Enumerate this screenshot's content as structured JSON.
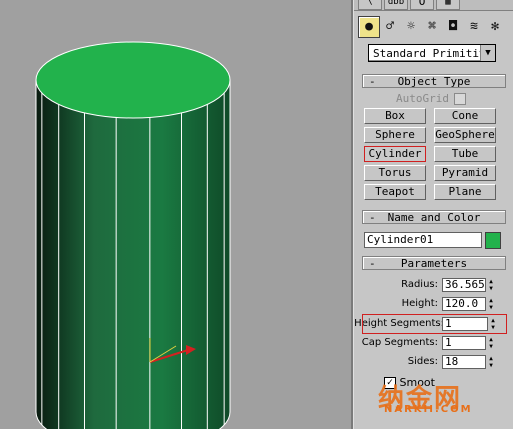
{
  "panel": {
    "tabs": [
      "\\",
      "dbb",
      "O",
      "▦"
    ],
    "icons": [
      {
        "name": "geometry-icon",
        "glyph": "●"
      },
      {
        "name": "shapes-icon",
        "glyph": "♂"
      },
      {
        "name": "lights-icon",
        "glyph": "☼"
      },
      {
        "name": "cameras-icon",
        "glyph": "⌘"
      },
      {
        "name": "helpers-icon",
        "glyph": "◘"
      },
      {
        "name": "spacewarps-icon",
        "glyph": "≋"
      },
      {
        "name": "systems-icon",
        "glyph": "✻"
      }
    ],
    "category_dropdown": "Standard Primitiv",
    "object_type": {
      "title": "Object Type",
      "autogrid": "AutoGrid",
      "buttons": [
        [
          "Box",
          "Cone"
        ],
        [
          "Sphere",
          "GeoSphere"
        ],
        [
          "Cylinder",
          "Tube"
        ],
        [
          "Torus",
          "Pyramid"
        ],
        [
          "Teapot",
          "Plane"
        ]
      ],
      "selected": "Cylinder"
    },
    "name_and_color": {
      "title": "Name and Color",
      "name": "Cylinder01",
      "color": "#22b24c"
    },
    "parameters": {
      "title": "Parameters",
      "radius_label": "Radius:",
      "radius": "36.565",
      "height_label": "Height:",
      "height": "120.0",
      "height_segments_label": "Height Segments:",
      "height_segments": "1",
      "cap_segments_label": "Cap Segments:",
      "cap_segments": "1",
      "sides_label": "Sides:",
      "sides": "18",
      "smooth_label": "Smoot"
    }
  },
  "viewport": {
    "object_color": "#1f8a46",
    "top_color": "#22b24c"
  },
  "watermark": {
    "main": "纳金网",
    "sub": "NARKII.COM"
  }
}
